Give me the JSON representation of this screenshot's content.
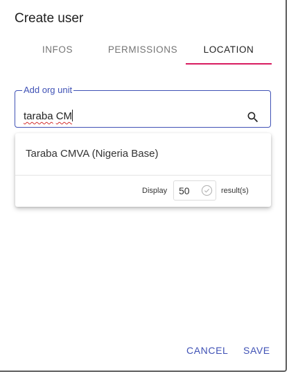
{
  "dialog": {
    "title": "Create user"
  },
  "tabs": [
    {
      "label": "INFOS",
      "active": false
    },
    {
      "label": "PERMISSIONS",
      "active": false
    },
    {
      "label": "LOCATION",
      "active": true
    }
  ],
  "org_unit": {
    "label": "Add org unit",
    "value": "taraba CM",
    "value_parts": [
      "taraba",
      " ",
      "CM"
    ],
    "search_icon": "search-icon"
  },
  "results": {
    "items": [
      "Taraba CMVA (Nigeria Base)"
    ],
    "display_label": "Display",
    "count_value": "50",
    "count_icon": "check-circle-icon",
    "results_label": "result(s)"
  },
  "actions": {
    "cancel_label": "CANCEL",
    "save_label": "SAVE"
  },
  "colors": {
    "accent": "#3f51b5",
    "tab_indicator": "#d81b60",
    "spell_error": "#d32f2f"
  }
}
